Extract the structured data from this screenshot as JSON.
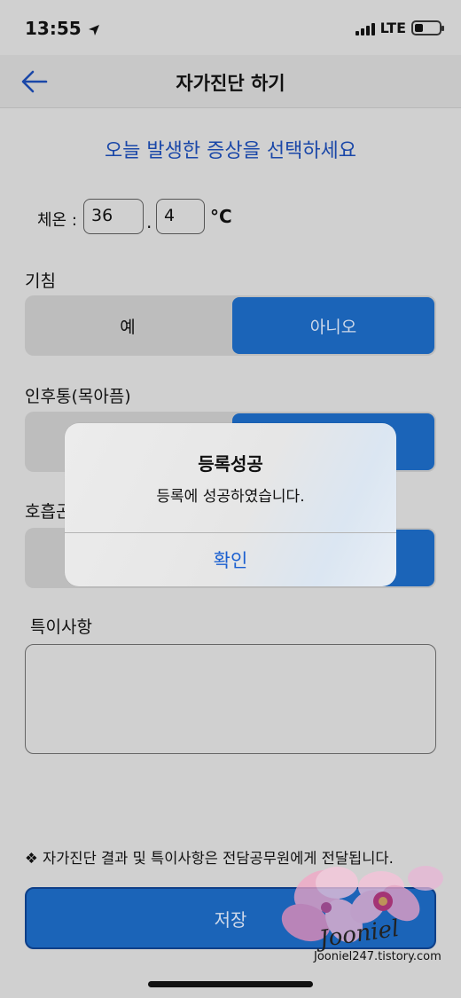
{
  "status_bar": {
    "time": "13:55",
    "network": "LTE"
  },
  "nav": {
    "title": "자가진단 하기"
  },
  "instruction": "오늘 발생한 증상을 선택하세요",
  "temperature": {
    "label": "체온 :",
    "integer": "36",
    "separator": ".",
    "decimal": "4",
    "unit": "°C"
  },
  "symptoms": [
    {
      "label": "기침",
      "yes": "예",
      "no": "아니오",
      "selected": "아니오"
    },
    {
      "label": "인후통(목아픔)",
      "yes": "",
      "no": "",
      "selected": "아니오"
    },
    {
      "label": "호흡곤",
      "yes": "",
      "no": "",
      "selected": "아니오"
    }
  ],
  "notes": {
    "label": "특이사항",
    "value": ""
  },
  "footnote": "❖ 자가진단 결과 및 특이사항은 전담공무원에게 전달됩니다.",
  "save_button": "저장",
  "alert": {
    "title": "등록성공",
    "message": "등록에 성공하였습니다.",
    "confirm": "확인"
  },
  "watermark": {
    "name": "Jooniel",
    "url": "Jooniel247.tistory.com"
  },
  "colors": {
    "accent": "#1b64b8",
    "link": "#1a5fd0",
    "background": "#d0d0d0"
  }
}
